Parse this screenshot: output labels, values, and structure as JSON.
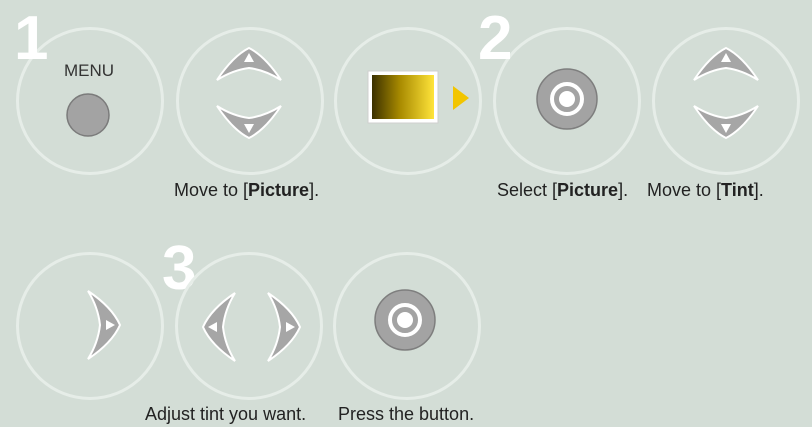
{
  "steps": [
    {
      "number": "1"
    },
    {
      "number": "2"
    },
    {
      "number": "3"
    }
  ],
  "menu_label": "MENU",
  "captions": {
    "move_picture": {
      "pre": "Move to [",
      "bold": "Picture",
      "post": "]."
    },
    "select_picture": {
      "pre": "Select [",
      "bold": "Picture",
      "post": "]."
    },
    "move_tint": {
      "pre": "Move to [",
      "bold": "Tint",
      "post": "]."
    },
    "adjust": "Adjust tint you want.",
    "press": "Press the button."
  },
  "colors": {
    "background": "#d3ddd6",
    "circle_outline": "#e6ede8",
    "button_gray": "#a3a3a3",
    "arrow_yellow": "#f2c500"
  }
}
